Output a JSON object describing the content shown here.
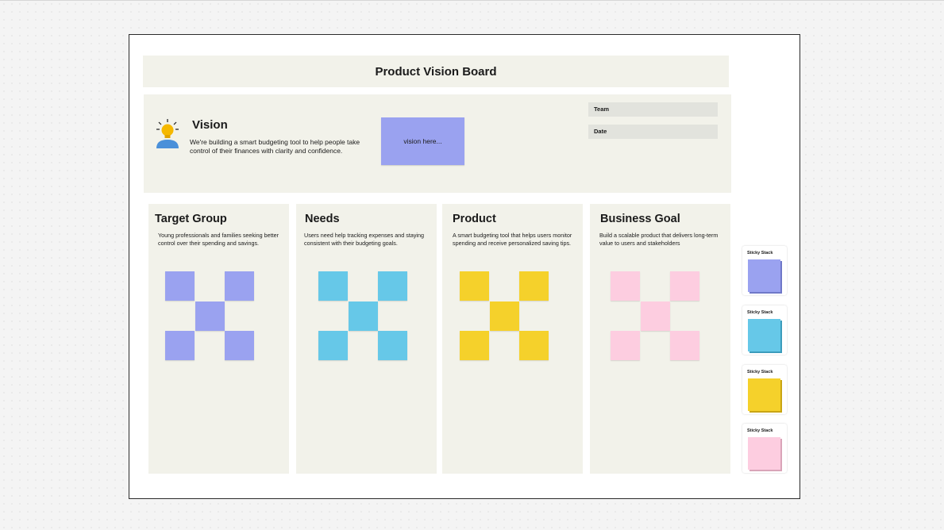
{
  "board": {
    "title": "Product Vision Board"
  },
  "vision": {
    "heading": "Vision",
    "description": "We're building a smart budgeting tool to help people take control of their finances with clarity and confidence.",
    "sticky_text": "vision here...",
    "sticky_color": "#9aa2f0",
    "icon": "lightbulb-person-icon",
    "team_label": "Team",
    "date_label": "Date"
  },
  "columns": [
    {
      "title": "Target Group",
      "description": "Young professionals and families seeking better control over their spending and savings.",
      "sticky_color": "#9aa2f0"
    },
    {
      "title": "Needs",
      "description": "Users need help tracking expenses and staying consistent with their budgeting goals.",
      "sticky_color": "#66c8e8"
    },
    {
      "title": "Product",
      "description": "A smart budgeting tool that helps users monitor spending and receive personalized saving tips.",
      "sticky_color": "#f5d12b"
    },
    {
      "title": "Business Goal",
      "description": "Build a scalable product that delivers long-term value to users and stakeholders",
      "sticky_color": "#fdcde0"
    }
  ],
  "sticky_stacks": [
    {
      "label": "Sticky Stack",
      "color": "#9aa2f0",
      "shadow": "#6f78c8"
    },
    {
      "label": "Sticky Stack",
      "color": "#66c8e8",
      "shadow": "#3c9cbc"
    },
    {
      "label": "Sticky Stack",
      "color": "#f5d12b",
      "shadow": "#c9a514"
    },
    {
      "label": "Sticky Stack",
      "color": "#fdcde0",
      "shadow": "#d9a4b8"
    }
  ]
}
